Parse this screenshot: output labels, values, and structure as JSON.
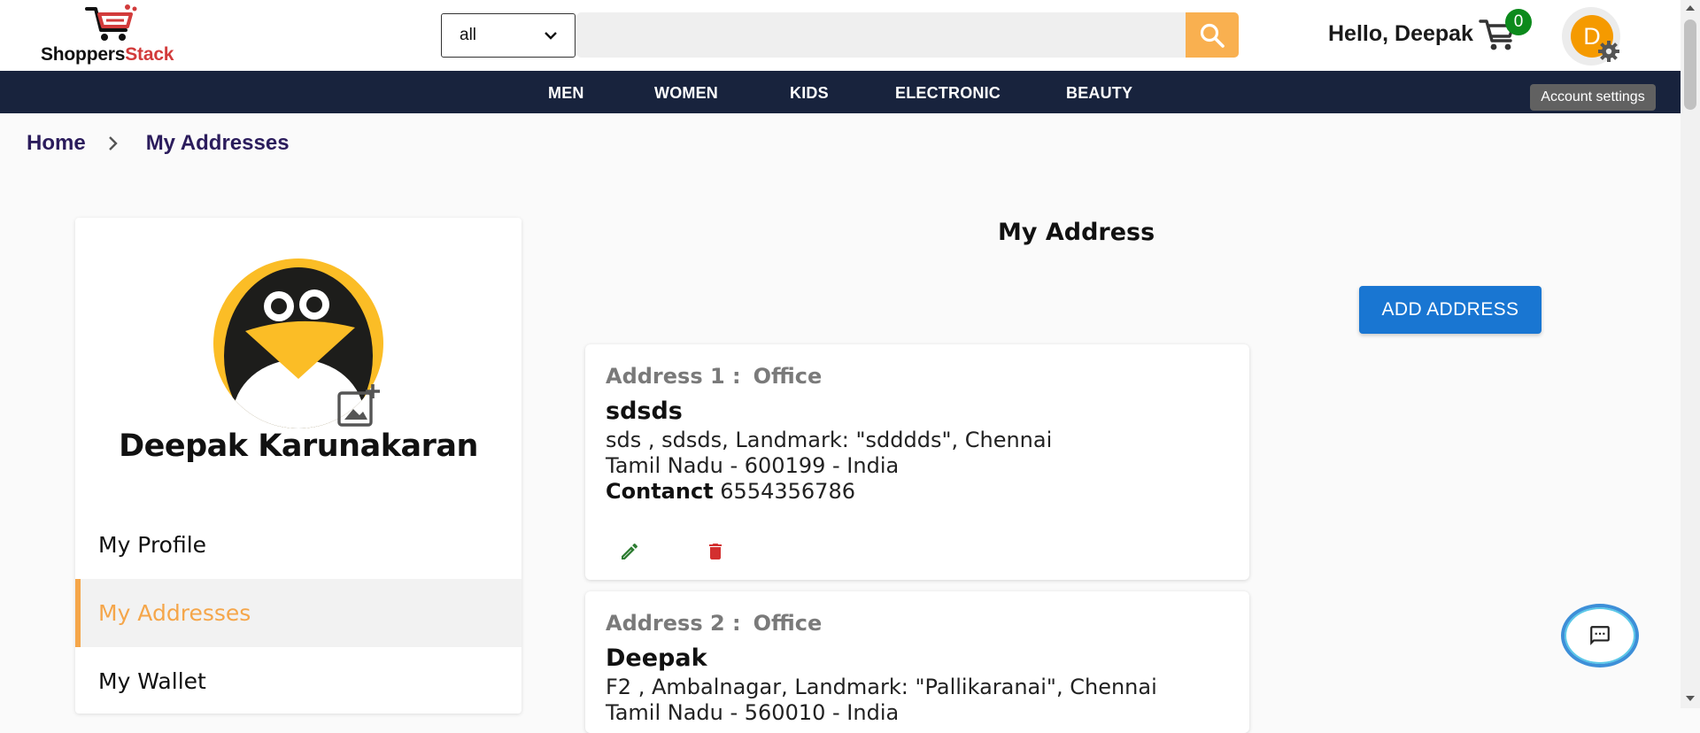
{
  "header": {
    "logo": {
      "text_a": "Shoppers",
      "text_b": "Stack"
    },
    "category_select": {
      "value": "all"
    },
    "search": {
      "placeholder": ""
    },
    "greeting": "Hello, Deepak",
    "cart_count": "0",
    "avatar_letter": "D",
    "tooltip": "Account settings"
  },
  "nav": {
    "items": [
      "MEN",
      "WOMEN",
      "KIDS",
      "ELECTRONIC",
      "BEAUTY"
    ]
  },
  "breadcrumb": {
    "home": "Home",
    "current": "My Addresses"
  },
  "sidebar": {
    "profile_name": "Deepak Karunakaran",
    "menu": [
      "My Profile",
      "My Addresses",
      "My Wallet"
    ]
  },
  "main": {
    "title": "My Address",
    "add_button": "ADD ADDRESS",
    "addresses": [
      {
        "label": "Address 1 :",
        "type": "Office",
        "name": "sdsds",
        "line1": "sds , sdsds, Landmark: \"sdddds\", Chennai",
        "line2": "Tamil Nadu - 600199 - India",
        "contact_label": "Contanct",
        "contact": "6554356786"
      },
      {
        "label": "Address 2 :",
        "type": "Office",
        "name": "Deepak",
        "line1": "F2 , Ambalnagar, Landmark: \"Pallikaranai\", Chennai",
        "line2": "Tamil Nadu - 560010 - India"
      }
    ]
  },
  "colors": {
    "nav_bg": "#18233d",
    "accent_orange": "#f5a64a",
    "primary_blue": "#1976d2",
    "badge_green": "#0c8a1c",
    "delete_red": "#d32f2f",
    "edit_green": "#2e7d32"
  },
  "icons": [
    "cart-logo-icon",
    "chevron-down-icon",
    "search-icon",
    "cart-icon",
    "gear-icon",
    "chevron-right-icon",
    "add-photo-icon",
    "edit-icon",
    "delete-icon",
    "chat-icon"
  ]
}
